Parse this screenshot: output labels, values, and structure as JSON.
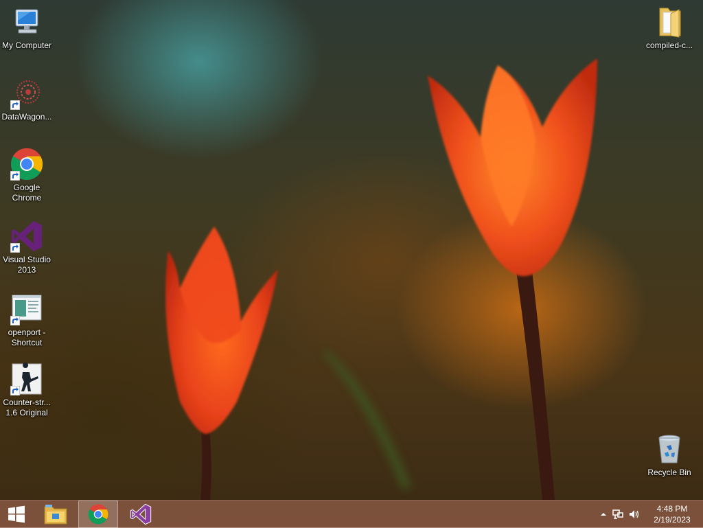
{
  "desktop": {
    "icons_left": [
      {
        "label": "My Computer",
        "icon": "my-computer-icon"
      },
      {
        "label": "DataWagon...",
        "icon": "datawagon-icon"
      },
      {
        "label": "Google Chrome",
        "icon": "chrome-icon"
      },
      {
        "label": "Visual Studio 2013",
        "icon": "visual-studio-icon"
      },
      {
        "label": "openport - Shortcut",
        "icon": "openport-icon"
      },
      {
        "label": "Counter-str... 1.6 Original",
        "icon": "counter-strike-icon"
      }
    ],
    "icons_right": [
      {
        "label": "compiled-c...",
        "icon": "folder-icon"
      },
      {
        "label": "Recycle Bin",
        "icon": "recycle-bin-icon"
      }
    ]
  },
  "taskbar": {
    "pinned": [
      {
        "icon": "windows-start-icon",
        "active": false
      },
      {
        "icon": "file-explorer-icon",
        "active": false
      },
      {
        "icon": "chrome-icon",
        "active": true
      },
      {
        "icon": "visual-studio-icon",
        "active": false
      }
    ],
    "tray": {
      "icons": [
        "show-hidden-icons-icon",
        "network-icon",
        "volume-icon"
      ],
      "time": "4:48 PM",
      "date": "2/19/2023"
    }
  },
  "colors": {
    "taskbar": "#9a5f4b",
    "tulip_red": "#e8421a",
    "tulip_orange": "#ff8a2a",
    "visual_studio": "#68217a"
  }
}
